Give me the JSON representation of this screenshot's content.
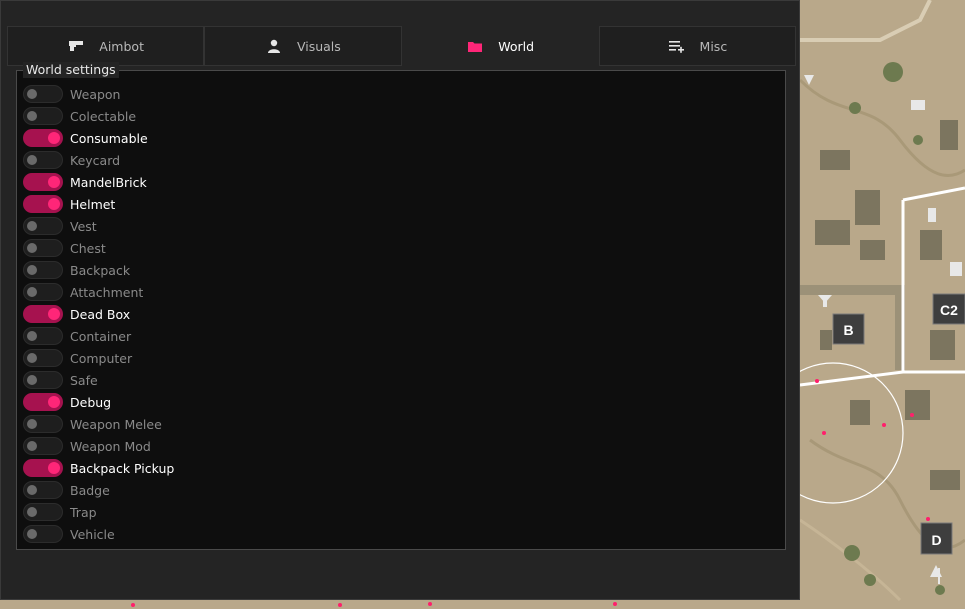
{
  "tabs": [
    {
      "label": "Aimbot",
      "icon": "gun-icon",
      "active": false
    },
    {
      "label": "Visuals",
      "icon": "person-icon",
      "active": false
    },
    {
      "label": "World",
      "icon": "folder-icon",
      "active": true
    },
    {
      "label": "Misc",
      "icon": "list-add-icon",
      "active": false
    }
  ],
  "group_title": "World settings",
  "items": [
    {
      "label": "Weapon",
      "on": false
    },
    {
      "label": "Colectable",
      "on": false
    },
    {
      "label": "Consumable",
      "on": true
    },
    {
      "label": "Keycard",
      "on": false
    },
    {
      "label": "MandelBrick",
      "on": true
    },
    {
      "label": "Helmet",
      "on": true
    },
    {
      "label": "Vest",
      "on": false
    },
    {
      "label": "Chest",
      "on": false
    },
    {
      "label": "Backpack",
      "on": false
    },
    {
      "label": "Attachment",
      "on": false
    },
    {
      "label": "Dead Box",
      "on": true
    },
    {
      "label": "Container",
      "on": false
    },
    {
      "label": "Computer",
      "on": false
    },
    {
      "label": "Safe",
      "on": false
    },
    {
      "label": "Debug",
      "on": true
    },
    {
      "label": "Weapon Melee",
      "on": false
    },
    {
      "label": "Weapon Mod",
      "on": false
    },
    {
      "label": "Backpack Pickup",
      "on": true
    },
    {
      "label": "Badge",
      "on": false
    },
    {
      "label": "Trap",
      "on": false
    },
    {
      "label": "Vehicle",
      "on": false
    }
  ],
  "map": {
    "markers": [
      "B",
      "C2",
      "D"
    ]
  },
  "colors": {
    "accent": "#ff2678",
    "toggle_on": "#a6124f",
    "panel": "#242424",
    "group_bg": "#0e0e0e"
  }
}
